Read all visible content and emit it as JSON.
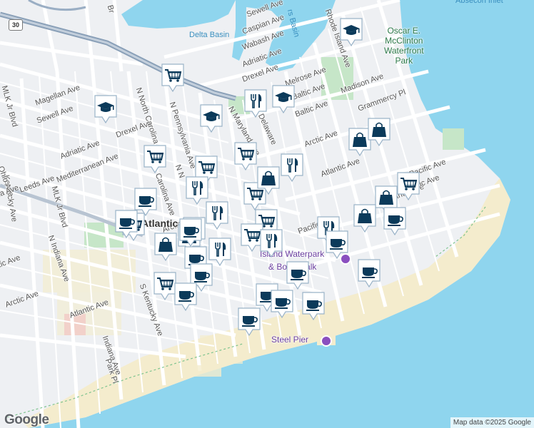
{
  "map": {
    "attribution": "Map data ©2025 Google",
    "logo_text": "Google",
    "route_shield": "30",
    "colors": {
      "ocean": "#8fd5ee",
      "land": "#eef0f3",
      "road": "#ffffff",
      "highway": "#8aa0b8",
      "park": "#c6e6c8",
      "beach": "#f4eccd",
      "marker_fill": "#ffffff",
      "marker_icon": "#0b3a5a",
      "poi": "#8a4fbf"
    },
    "street_labels": [
      {
        "text": "Sewell Ave"
      },
      {
        "text": "Caspian Ave"
      },
      {
        "text": "Wabash Ave"
      },
      {
        "text": "Adriatic Ave"
      },
      {
        "text": "Drexel Ave"
      },
      {
        "text": "Melrose Ave"
      },
      {
        "text": "Baltic Ave"
      },
      {
        "text": "Arctic Ave"
      },
      {
        "text": "Atlantic Ave"
      },
      {
        "text": "Pacific Ave"
      },
      {
        "text": "Madison Ave"
      },
      {
        "text": "Grammercy Pl"
      },
      {
        "text": "Kentucky Ave"
      },
      {
        "text": "Magellan Ave"
      },
      {
        "text": "Sewell Ave"
      },
      {
        "text": "MLK Jr Blvd"
      },
      {
        "text": "MLK Jr Blvd"
      },
      {
        "text": "Adriatic Ave"
      },
      {
        "text": "Drexel Ave"
      },
      {
        "text": "Leeds Ave"
      },
      {
        "text": "Mediterranean Ave"
      },
      {
        "text": "N North Carolina Ave"
      },
      {
        "text": "N Pennsylvania Ave"
      },
      {
        "text": "N Maryland Ave"
      },
      {
        "text": "Delaware"
      },
      {
        "text": "Arctic Ave"
      },
      {
        "text": "Baltic Ave"
      },
      {
        "text": "Arctic Ave"
      },
      {
        "text": "Atlantic Ave"
      },
      {
        "text": "N Indiana Ave"
      },
      {
        "text": "S Kentucky Ave"
      },
      {
        "text": "Indiana Ave"
      },
      {
        "text": "Park Pl"
      },
      {
        "text": "Rhode Island Ave"
      },
      {
        "text": "Pacific Ave"
      },
      {
        "text": "Atlantic Ave"
      },
      {
        "text": "Pacific Ave"
      },
      {
        "text": "Carolina Ave"
      },
      {
        "text": "N N"
      },
      {
        "text": "Ohio Ave"
      },
      {
        "text": "Br"
      },
      {
        "text": "ia Ave"
      },
      {
        "text": "tic Ave"
      }
    ],
    "water_labels": [
      {
        "text": "Delta Basin"
      },
      {
        "text": "rs Basin"
      },
      {
        "text": "Absecon Inlet"
      }
    ],
    "park_label": {
      "lines": [
        "Oscar E.",
        "McClinton",
        "Waterfront",
        "Park"
      ]
    },
    "poi_labels": [
      {
        "text": "Steel Pier"
      },
      {
        "text": "Island Waterpark"
      },
      {
        "text": "& Boardwalk"
      }
    ],
    "city_label": {
      "text": "Atlantic Ci"
    },
    "markers": [
      {
        "icon": "school"
      },
      {
        "icon": "school"
      },
      {
        "icon": "school"
      },
      {
        "icon": "school"
      },
      {
        "icon": "cart"
      },
      {
        "icon": "cart"
      },
      {
        "icon": "cart"
      },
      {
        "icon": "cart"
      },
      {
        "icon": "cart"
      },
      {
        "icon": "cart"
      },
      {
        "icon": "cart"
      },
      {
        "icon": "cart"
      },
      {
        "icon": "cart"
      },
      {
        "icon": "cart"
      },
      {
        "icon": "food"
      },
      {
        "icon": "food"
      },
      {
        "icon": "food"
      },
      {
        "icon": "food"
      },
      {
        "icon": "food"
      },
      {
        "icon": "food"
      },
      {
        "icon": "food"
      },
      {
        "icon": "food"
      },
      {
        "icon": "bag"
      },
      {
        "icon": "bag"
      },
      {
        "icon": "bag"
      },
      {
        "icon": "bag"
      },
      {
        "icon": "bag"
      },
      {
        "icon": "bag"
      },
      {
        "icon": "bag"
      },
      {
        "icon": "cup"
      },
      {
        "icon": "cup"
      },
      {
        "icon": "cup"
      },
      {
        "icon": "cup"
      },
      {
        "icon": "cup"
      },
      {
        "icon": "cup"
      },
      {
        "icon": "cup"
      },
      {
        "icon": "cup"
      },
      {
        "icon": "cup"
      },
      {
        "icon": "cup"
      },
      {
        "icon": "cup"
      },
      {
        "icon": "cup"
      },
      {
        "icon": "cup"
      },
      {
        "icon": "cup"
      }
    ]
  }
}
